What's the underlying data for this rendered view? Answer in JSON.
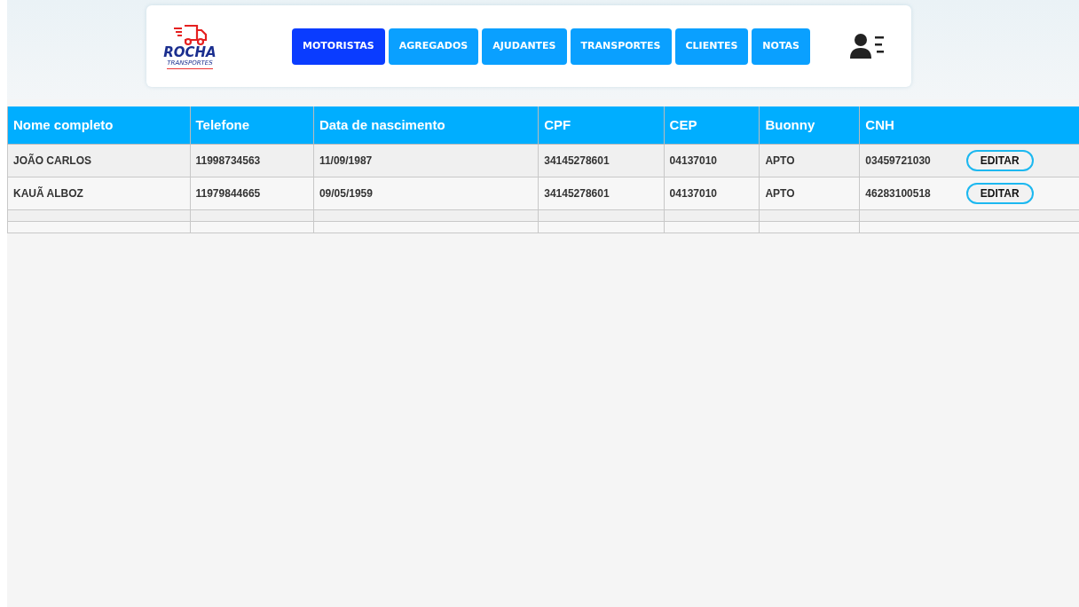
{
  "logo": {
    "name": "ROCHA",
    "tagline": "TRANSPORTES"
  },
  "nav": [
    {
      "label": "MOTORISTAS",
      "selected": true
    },
    {
      "label": "AGREGADOS",
      "selected": false
    },
    {
      "label": "AJUDANTES",
      "selected": false
    },
    {
      "label": "TRANSPORTES",
      "selected": false
    },
    {
      "label": "CLIENTES",
      "selected": false
    },
    {
      "label": "NOTAS",
      "selected": false
    }
  ],
  "table": {
    "columns": [
      "Nome completo",
      "Telefone",
      "Data de nascimento",
      "CPF",
      "CEP",
      "Buonny",
      "CNH"
    ],
    "rows": [
      {
        "cells": [
          "JOÃO CARLOS",
          "11998734563",
          "11/09/1987",
          "34145278601",
          "04137010",
          "APTO",
          "03459721030"
        ],
        "action": "EDITAR"
      },
      {
        "cells": [
          "KAUÃ ALBOZ",
          "11979844665",
          "09/05/1959",
          "34145278601",
          "04137010",
          "APTO",
          "46283100518"
        ],
        "action": "EDITAR"
      }
    ]
  }
}
